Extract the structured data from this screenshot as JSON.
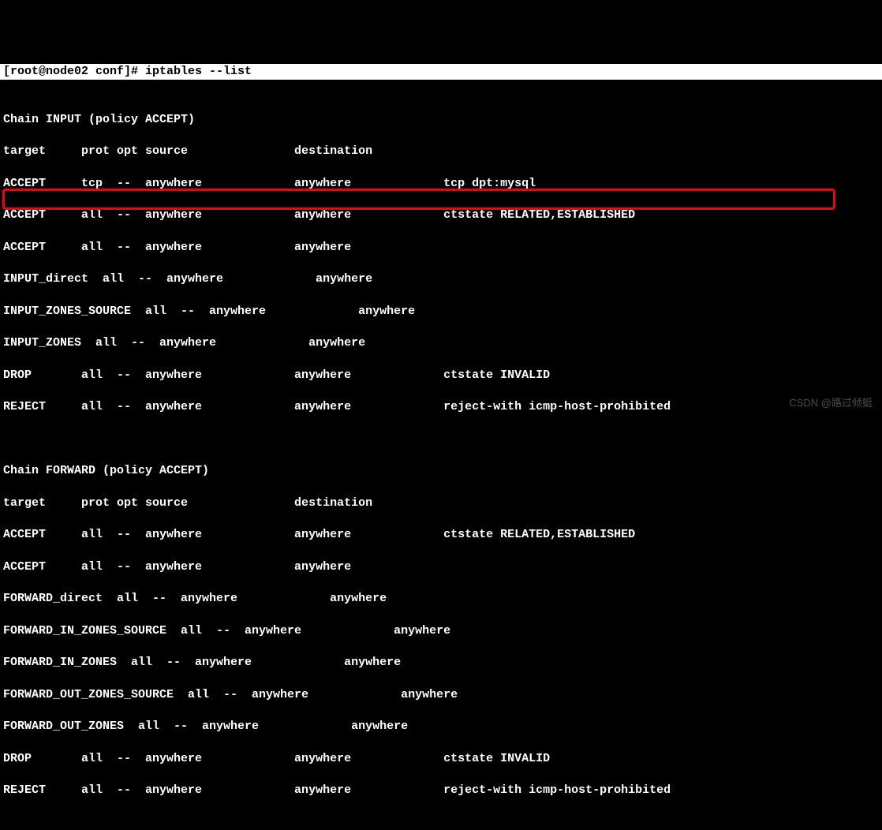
{
  "prompt": "[root@node02 conf]# iptables --list",
  "chain_input_header": "Chain INPUT (policy ACCEPT)",
  "input_cols": "target     prot opt source               destination",
  "input_rules": [
    "ACCEPT     tcp  --  anywhere             anywhere             tcp dpt:mysql",
    "ACCEPT     all  --  anywhere             anywhere             ctstate RELATED,ESTABLISHED",
    "ACCEPT     all  --  anywhere             anywhere",
    "INPUT_direct  all  --  anywhere             anywhere",
    "INPUT_ZONES_SOURCE  all  --  anywhere             anywhere",
    "INPUT_ZONES  all  --  anywhere             anywhere",
    "DROP       all  --  anywhere             anywhere             ctstate INVALID",
    "REJECT     all  --  anywhere             anywhere             reject-with icmp-host-prohibited"
  ],
  "chain_forward_header": "Chain FORWARD (policy ACCEPT)",
  "forward_cols": "target     prot opt source               destination",
  "forward_rules": [
    "ACCEPT     all  --  anywhere             anywhere             ctstate RELATED,ESTABLISHED",
    "ACCEPT     all  --  anywhere             anywhere",
    "FORWARD_direct  all  --  anywhere             anywhere",
    "FORWARD_IN_ZONES_SOURCE  all  --  anywhere             anywhere",
    "FORWARD_IN_ZONES  all  --  anywhere             anywhere",
    "FORWARD_OUT_ZONES_SOURCE  all  --  anywhere             anywhere",
    "FORWARD_OUT_ZONES  all  --  anywhere             anywhere",
    "DROP       all  --  anywhere             anywhere             ctstate INVALID",
    "REJECT     all  --  anywhere             anywhere             reject-with icmp-host-prohibited"
  ],
  "watermark": "CSDN @路过倾蜓"
}
